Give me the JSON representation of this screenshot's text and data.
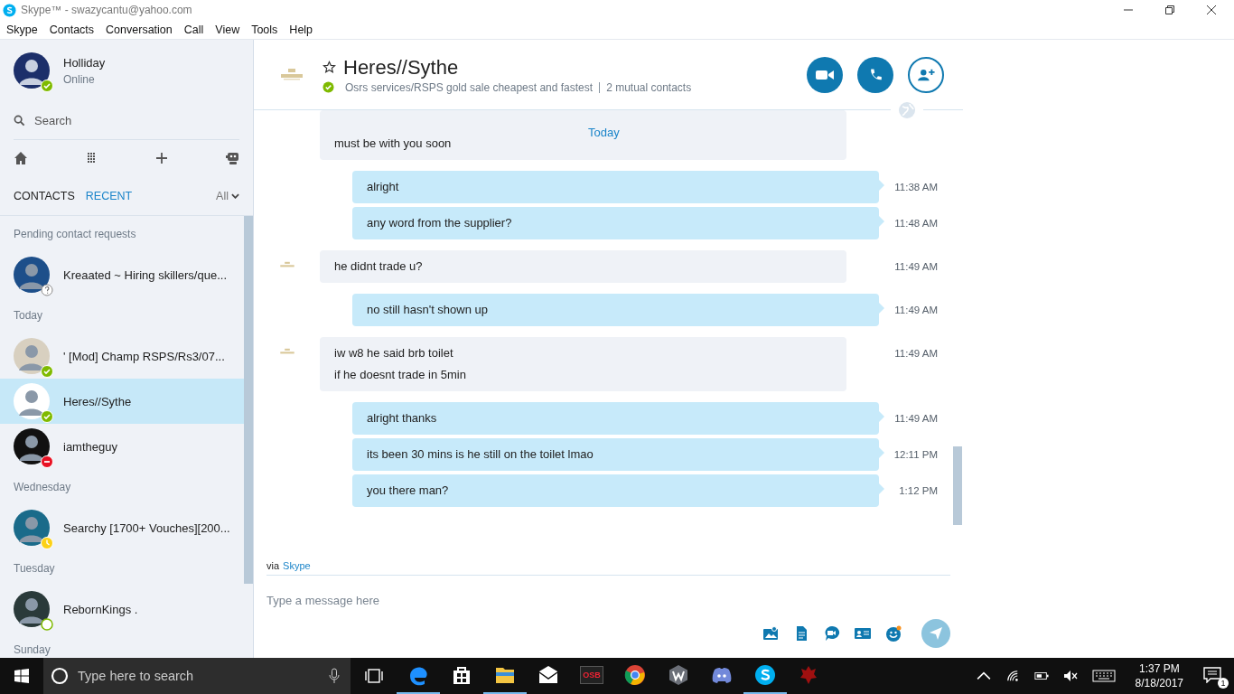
{
  "window": {
    "title": "Skype™ - swazycantu@yahoo.com"
  },
  "menu": [
    "Skype",
    "Contacts",
    "Conversation",
    "Call",
    "View",
    "Tools",
    "Help"
  ],
  "profile": {
    "name": "Holliday",
    "status_text": "Online",
    "badge": {
      "kind": "online"
    }
  },
  "search": {
    "placeholder": "Search"
  },
  "list_tabs": [
    {
      "label": "CONTACTS",
      "selected": false
    },
    {
      "label": "RECENT",
      "selected": true
    }
  ],
  "filter": {
    "label": "All"
  },
  "contact_groups": [
    {
      "heading": "Pending contact requests",
      "contacts": [
        {
          "name": "Kreaated ~ Hiring skillers/que...",
          "badge": {
            "kind": "unknown"
          },
          "selected": false
        }
      ]
    },
    {
      "heading": "Today",
      "contacts": [
        {
          "name": "' [Mod] Champ RSPS/Rs3/07...",
          "badge": {
            "kind": "online"
          },
          "selected": false
        },
        {
          "name": "Heres//Sythe",
          "badge": {
            "kind": "online"
          },
          "selected": true
        },
        {
          "name": "iamtheguy",
          "badge": {
            "kind": "dnd"
          },
          "selected": false
        }
      ]
    },
    {
      "heading": "Wednesday",
      "contacts": [
        {
          "name": "Searchy [1700+ Vouches][200...",
          "badge": {
            "kind": "away"
          },
          "selected": false
        }
      ]
    },
    {
      "heading": "Tuesday",
      "contacts": [
        {
          "name": "RebornKings .",
          "badge": {
            "kind": "offline"
          },
          "selected": false
        }
      ]
    },
    {
      "heading": "Sunday"
    }
  ],
  "conversation": {
    "name": "Heres//Sythe",
    "badge": {
      "kind": "online"
    },
    "mood": "Osrs services/RSPS gold sale cheapest and fastest",
    "mutual": "2 mutual contacts",
    "day": "Today"
  },
  "messages": [
    {
      "kind": "incoming",
      "lines": [
        "must be with you soon"
      ]
    },
    {
      "kind": "outgoing",
      "lines": [
        "alright"
      ],
      "time": "11:38 AM"
    },
    {
      "kind": "outgoing",
      "lines": [
        "any word from the supplier?"
      ],
      "time": "11:48 AM"
    },
    {
      "kind": "incoming",
      "lines": [
        "he didnt trade u?"
      ],
      "time": "11:49 AM"
    },
    {
      "kind": "outgoing",
      "lines": [
        "no still hasn't shown up"
      ],
      "time": "11:49 AM"
    },
    {
      "kind": "incoming",
      "lines": [
        "iw w8 he said brb toilet",
        "if he doesnt trade in 5min"
      ],
      "time": "11:49 AM"
    },
    {
      "kind": "outgoing",
      "lines": [
        "alright thanks"
      ],
      "time": "11:49 AM"
    },
    {
      "kind": "outgoing",
      "lines": [
        "its been 30 mins is he still on the toilet lmao"
      ],
      "time": "12:11 PM"
    },
    {
      "kind": "outgoing",
      "lines": [
        "you there man?"
      ],
      "time": "1:12 PM"
    }
  ],
  "via": {
    "prefix": "via",
    "link": "Skype"
  },
  "composer": {
    "placeholder": "Type a message here"
  },
  "taskbar": {
    "search_placeholder": "Type here to search",
    "apps": [
      {
        "kind": "edge",
        "running": true
      },
      {
        "kind": "store",
        "running": false
      },
      {
        "kind": "explorer",
        "running": true
      },
      {
        "kind": "mail",
        "running": false
      },
      {
        "kind": "osb",
        "label": "OSB",
        "running": false
      },
      {
        "kind": "chrome",
        "running": false
      },
      {
        "kind": "w",
        "running": false
      },
      {
        "kind": "discord",
        "running": false
      },
      {
        "kind": "skype",
        "running": true
      },
      {
        "kind": "horde",
        "running": false
      }
    ],
    "time": "1:37 PM",
    "date": "8/18/2017",
    "notifications": "1"
  }
}
